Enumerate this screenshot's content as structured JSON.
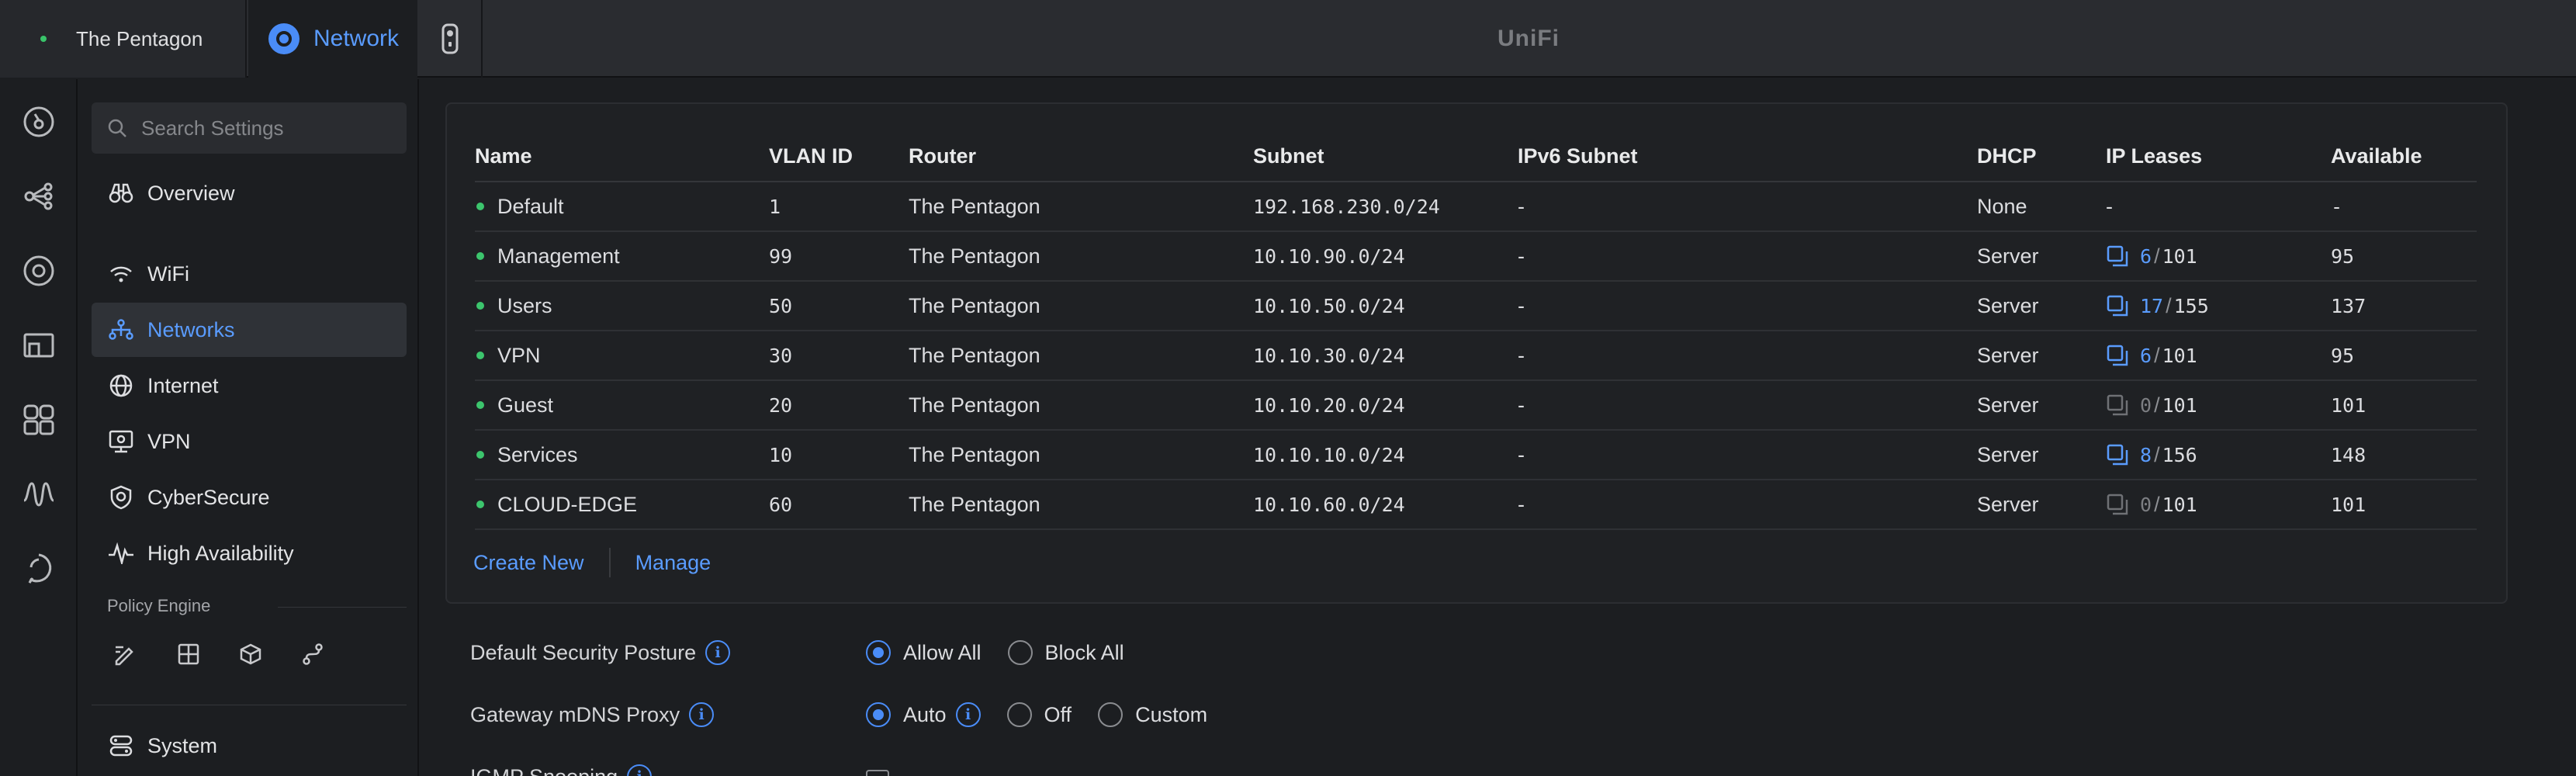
{
  "topbar": {
    "site_name": "The Pentagon",
    "app_tab": "Network",
    "brand": "UniFi"
  },
  "rail": {
    "icons": [
      "dashboard-icon",
      "topology-icon",
      "devices-icon",
      "client-devices-icon",
      "ports-icon",
      "insights-icon",
      "support-icon"
    ]
  },
  "sidebar": {
    "search_placeholder": "Search Settings",
    "items": [
      {
        "label": "Overview",
        "icon": "binoculars-icon"
      },
      {
        "label": "WiFi",
        "icon": "wifi-icon"
      },
      {
        "label": "Networks",
        "icon": "networks-icon",
        "active": true
      },
      {
        "label": "Internet",
        "icon": "globe-icon"
      },
      {
        "label": "VPN",
        "icon": "vpn-icon"
      },
      {
        "label": "CyberSecure",
        "icon": "shield-icon"
      },
      {
        "label": "High Availability",
        "icon": "pulse-icon"
      }
    ],
    "policy_engine_label": "Policy Engine",
    "policy_icons": [
      "policy-edit-icon",
      "policy-table-icon",
      "policy-object-icon",
      "policy-route-icon"
    ],
    "system_label": "System"
  },
  "networks_table": {
    "headers": {
      "name": "Name",
      "vlan": "VLAN ID",
      "router": "Router",
      "subnet": "Subnet",
      "ipv6": "IPv6 Subnet",
      "dhcp": "DHCP",
      "leases": "IP Leases",
      "available": "Available"
    },
    "rows": [
      {
        "name": "Default",
        "vlan": "1",
        "router": "The Pentagon",
        "subnet": "192.168.230.0/24",
        "ipv6": "-",
        "dhcp": "None",
        "leases_text": "-",
        "available": "-"
      },
      {
        "name": "Management",
        "vlan": "99",
        "router": "The Pentagon",
        "subnet": "10.10.90.0/24",
        "ipv6": "-",
        "dhcp": "Server",
        "used": "6",
        "total": "101",
        "available": "95"
      },
      {
        "name": "Users",
        "vlan": "50",
        "router": "The Pentagon",
        "subnet": "10.10.50.0/24",
        "ipv6": "-",
        "dhcp": "Server",
        "used": "17",
        "total": "155",
        "available": "137"
      },
      {
        "name": "VPN",
        "vlan": "30",
        "router": "The Pentagon",
        "subnet": "10.10.30.0/24",
        "ipv6": "-",
        "dhcp": "Server",
        "used": "6",
        "total": "101",
        "available": "95"
      },
      {
        "name": "Guest",
        "vlan": "20",
        "router": "The Pentagon",
        "subnet": "10.10.20.0/24",
        "ipv6": "-",
        "dhcp": "Server",
        "used": "0",
        "total": "101",
        "available": "101"
      },
      {
        "name": "Services",
        "vlan": "10",
        "router": "The Pentagon",
        "subnet": "10.10.10.0/24",
        "ipv6": "-",
        "dhcp": "Server",
        "used": "8",
        "total": "156",
        "available": "148"
      },
      {
        "name": "CLOUD-EDGE",
        "vlan": "60",
        "router": "The Pentagon",
        "subnet": "10.10.60.0/24",
        "ipv6": "-",
        "dhcp": "Server",
        "used": "0",
        "total": "101",
        "available": "101"
      }
    ],
    "create_new": "Create New",
    "manage": "Manage"
  },
  "settings": {
    "security_posture": {
      "label": "Default Security Posture",
      "options": [
        "Allow All",
        "Block All"
      ],
      "selected": "Allow All"
    },
    "mdns_proxy": {
      "label": "Gateway mDNS Proxy",
      "options": [
        "Auto",
        "Off",
        "Custom"
      ],
      "selected": "Auto"
    },
    "igmp_snooping": {
      "label": "IGMP Snooping"
    }
  },
  "colors": {
    "accent": "#4a8cf7",
    "status_online": "#3cc56d",
    "background": "#1c1e21"
  }
}
